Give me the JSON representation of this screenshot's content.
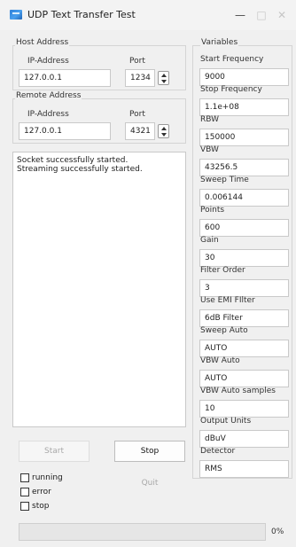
{
  "window": {
    "title": "UDP Text Transfer Test",
    "minimize_glyph": "—",
    "maximize_glyph": "□",
    "close_glyph": "✕"
  },
  "host": {
    "group_label": "Host Address",
    "ip_label": "IP-Address",
    "port_label": "Port",
    "ip_value": "127.0.0.1",
    "port_value": "1234"
  },
  "remote": {
    "group_label": "Remote Address",
    "ip_label": "IP-Address",
    "port_label": "Port",
    "ip_value": "127.0.0.1",
    "port_value": "4321"
  },
  "log": {
    "lines": [
      "Socket successfully started.",
      "Streaming successfully started."
    ]
  },
  "buttons": {
    "start": "Start",
    "stop": "Stop",
    "quit": "Quit"
  },
  "status": {
    "running": "running",
    "error": "error",
    "stop": "stop"
  },
  "progress": {
    "value_pct": 0,
    "text": "0%"
  },
  "variables": {
    "group_label": "Variables",
    "items": [
      {
        "label": "Start Frequency",
        "value": "9000"
      },
      {
        "label": "Stop Frequency",
        "value": "1.1e+08"
      },
      {
        "label": "RBW",
        "value": "150000"
      },
      {
        "label": "VBW",
        "value": "43256.5"
      },
      {
        "label": "Sweep Time",
        "value": "0.006144"
      },
      {
        "label": "Points",
        "value": "600"
      },
      {
        "label": "Gain",
        "value": "30"
      },
      {
        "label": "Filter Order",
        "value": "3"
      },
      {
        "label": "Use EMI FIlter",
        "value": "6dB Filter"
      },
      {
        "label": "Sweep Auto",
        "value": "AUTO"
      },
      {
        "label": "VBW Auto",
        "value": "AUTO"
      },
      {
        "label": "VBW Auto samples",
        "value": "10"
      },
      {
        "label": "Output Units",
        "value": "dBuV"
      },
      {
        "label": "Detector",
        "value": "RMS"
      }
    ]
  },
  "colors": {
    "progress_fill": "#06b025",
    "app_icon": "#2f7fd8"
  }
}
